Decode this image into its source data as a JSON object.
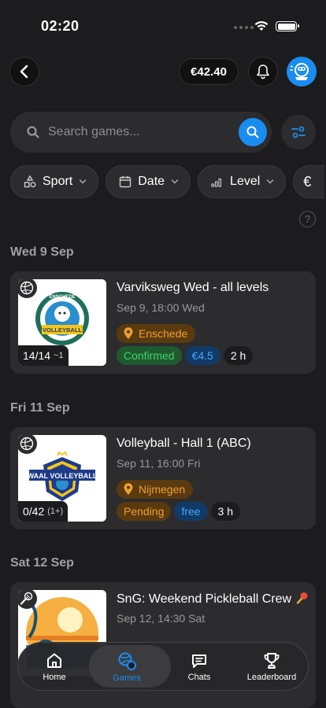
{
  "status_bar": {
    "time": "02:20"
  },
  "header": {
    "balance": "€42.40"
  },
  "search": {
    "placeholder": "Search games..."
  },
  "filters": [
    {
      "label": "Sport",
      "icon": "shapes-icon"
    },
    {
      "label": "Date",
      "icon": "calendar-icon"
    },
    {
      "label": "Level",
      "icon": "signal-bars-icon"
    },
    {
      "label": "",
      "icon": "euro-icon"
    }
  ],
  "help_glyph": "?",
  "sections": [
    {
      "date": "Wed 9 Sep",
      "game": {
        "title": "Varviksweg Wed - all levels",
        "time": "Sep 9, 18:00 Wed",
        "location": "Enschede",
        "status": "Confirmed",
        "price": "€4.5",
        "duration": "2 h",
        "count": "14/14",
        "count_sub": "~1",
        "sport_icon": "volleyball-icon",
        "logo_text": [
          "ENSCHEDE",
          "VOLLEYBALL"
        ]
      }
    },
    {
      "date": "Fri 11 Sep",
      "game": {
        "title": "Volleyball - Hall 1 (ABC)",
        "time": "Sep 11, 16:00 Fri",
        "location": "Nijmegen",
        "status": "Pending",
        "price": "free",
        "duration": "3 h",
        "count": "0/42",
        "count_sub": "(1+)",
        "sport_icon": "volleyball-icon",
        "logo_text": [
          "WAAL VOLLEYBALL"
        ]
      }
    },
    {
      "date": "Sat 12 Sep",
      "game": {
        "title": "SnG: Weekend Pickleball Crew",
        "time": "Sep 12, 14:30 Sat",
        "sport_icon": "pickleball-icon"
      }
    }
  ],
  "nav": [
    {
      "label": "Home",
      "icon": "home-icon"
    },
    {
      "label": "Games",
      "icon": "games-icon",
      "active": true
    },
    {
      "label": "Chats",
      "icon": "chat-icon"
    },
    {
      "label": "Leaderboard",
      "icon": "trophy-icon"
    }
  ],
  "colors": {
    "accent": "#1a8cf0",
    "confirmed": "#3fd36a",
    "pending": "#f0a030",
    "background": "#1c1c1e",
    "card": "#2c2c2e"
  }
}
